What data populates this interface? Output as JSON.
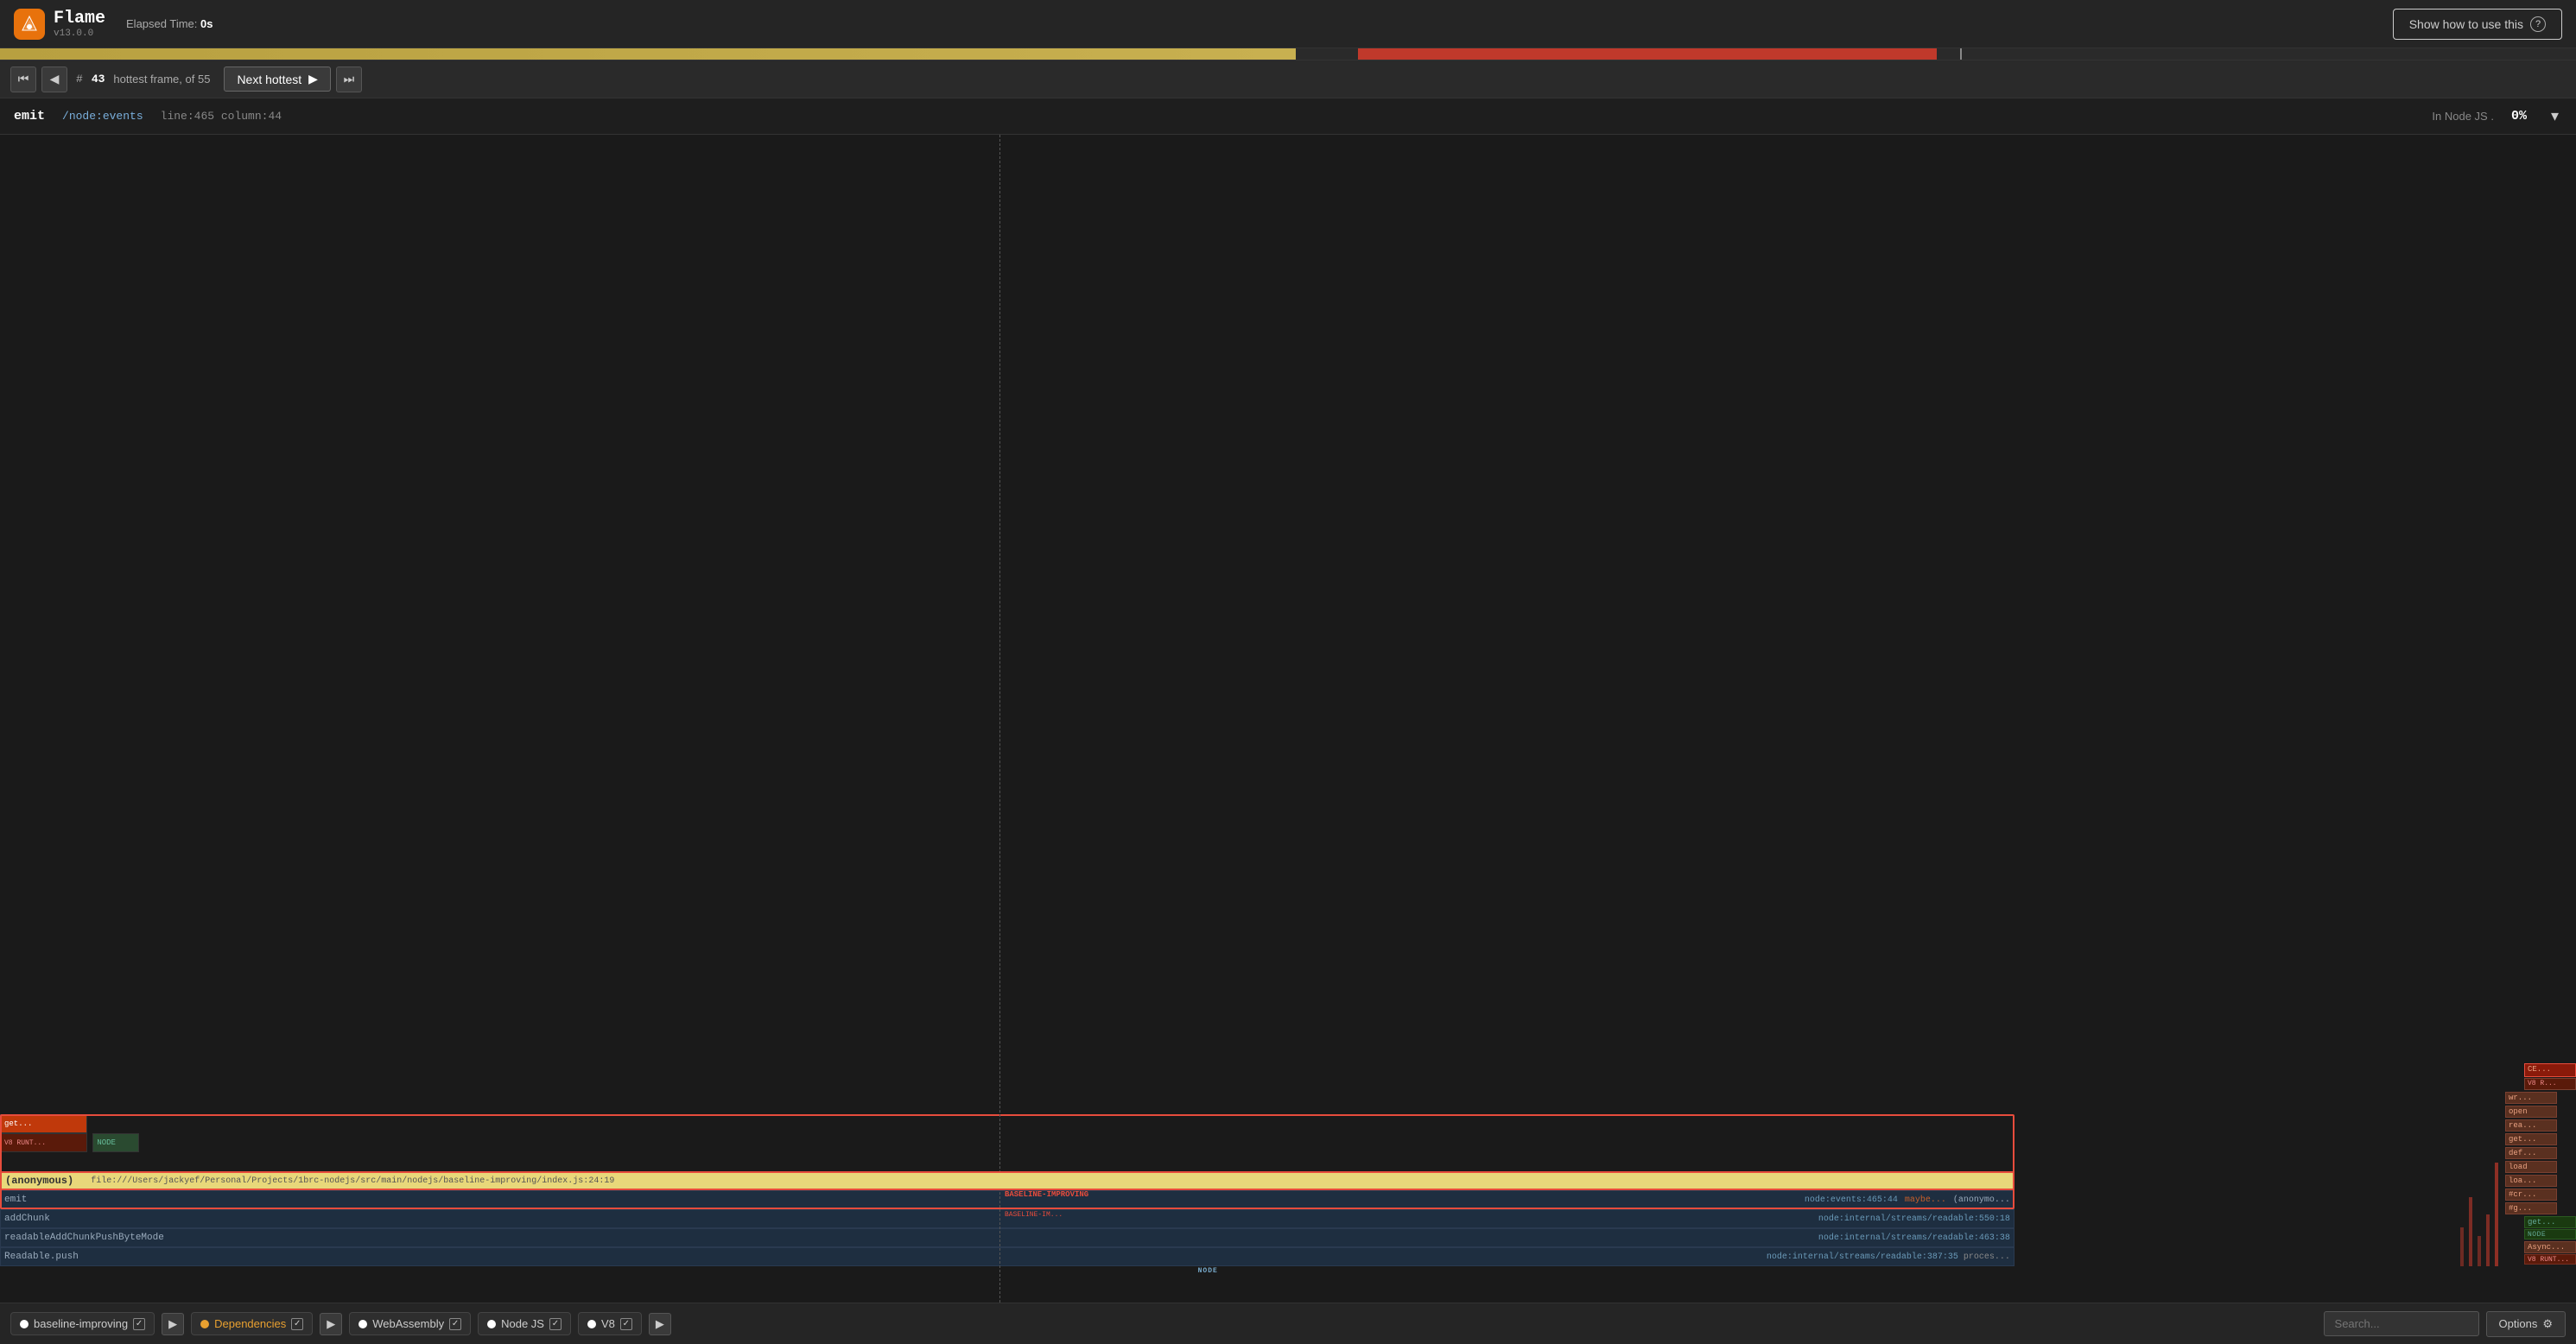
{
  "app": {
    "name": "Flame",
    "version": "v13.0.0",
    "logo_icon": "flame-icon"
  },
  "header": {
    "elapsed_label": "Elapsed Time:",
    "elapsed_value": "0s",
    "show_how_label": "Show how to use this",
    "question_icon": "?"
  },
  "timeline": {
    "yellow_width_pct": 50.3,
    "red_left_pct": 52.7,
    "red_width_pct": 22.5,
    "marker_left_pct": 76.1
  },
  "nav": {
    "first_btn": "⏮",
    "prev_btn": "◀",
    "hash": "#",
    "frame_number": "43",
    "frame_label": "hottest frame, of 55",
    "next_hottest_label": "Next hottest",
    "next_btn": "▶",
    "last_btn": "⏭"
  },
  "info_bar": {
    "func_name": "emit",
    "file": "/node:events",
    "line_col": "line:465  column:44",
    "in_node_label": "In Node JS .",
    "percent": "0%"
  },
  "flame_rows": [
    {
      "id": "row_get",
      "name": "get...",
      "badge": "V8 RUNT...",
      "badge_type": "v8",
      "left_pct": 0,
      "width_pct": 5.3,
      "color": "orange",
      "sub_label": ""
    },
    {
      "id": "row_anon",
      "name": "(anonymous)",
      "left_pct": 0,
      "width_pct": 77.8,
      "color": "yellow_bright",
      "file_label": "file:///Users/jackyef/Personal/Projects/1brc-nodejs/src/main/nodejs/baseline-improving/index.js:24:19",
      "sub_label": "BASELINE-IMPROVING"
    },
    {
      "id": "row_emit",
      "name": "emit",
      "left_pct": 0,
      "width_pct": 77.8,
      "color": "dark_node",
      "right_parts": [
        {
          "label": "node:events:465:44",
          "color": "node_loc"
        },
        {
          "label": "maybe...",
          "color": "orange_small"
        },
        {
          "label": "(anonymo...",
          "color": "node_dark"
        },
        {
          "sub": "BASELINE-IM...",
          "color": "red_sub"
        }
      ]
    },
    {
      "id": "row_addChunk",
      "name": "addChunk",
      "left_pct": 0,
      "width_pct": 77.8,
      "right_loc": "node:internal/streams/readable:550:18"
    },
    {
      "id": "row_readableAdd",
      "name": "readableAddChunkPushByteMode",
      "left_pct": 0,
      "width_pct": 77.8,
      "right_loc": "node:internal/streams/readable:463:38"
    },
    {
      "id": "row_readable_push",
      "name": "Readable.push",
      "left_pct": 0,
      "width_pct": 77.8,
      "right_loc": "node:internal/streams/readable:387:35",
      "extra": "proces...",
      "sub_label": "NODE"
    }
  ],
  "right_blocks": [
    {
      "label": "CE...",
      "row": 0,
      "sub": "V8 R..."
    },
    {
      "label": "wr...",
      "row": 1
    },
    {
      "label": "open",
      "row": 2
    },
    {
      "label": "rea...",
      "row": 3
    },
    {
      "label": "get...",
      "row": 4
    },
    {
      "label": "def...",
      "row": 5
    },
    {
      "label": "load",
      "row": 6
    },
    {
      "label": "loa...",
      "row": 7
    },
    {
      "label": "#cr...",
      "row": 8
    },
    {
      "label": "#g...",
      "row": 9
    },
    {
      "label": "get...",
      "row": 10,
      "sub": "NODE"
    },
    {
      "label": "Async...",
      "row": 11,
      "sub": "V8 RUNT..."
    }
  ],
  "bottom_bar": {
    "filters": [
      {
        "id": "baseline-improving",
        "dot_color": "#ffffff",
        "label": "baseline-improving",
        "checked": true
      },
      {
        "id": "dependencies",
        "dot_color": "#e8a030",
        "label": "Dependencies",
        "checked": true,
        "orange": true
      },
      {
        "id": "webassembly",
        "dot_color": "#ffffff",
        "label": "WebAssembly",
        "checked": true
      },
      {
        "id": "node-js",
        "dot_color": "#ffffff",
        "label": "Node JS",
        "checked": true
      },
      {
        "id": "v8",
        "dot_color": "#ffffff",
        "label": "V8",
        "checked": true
      }
    ],
    "search_placeholder": "Search...",
    "options_label": "Options"
  }
}
